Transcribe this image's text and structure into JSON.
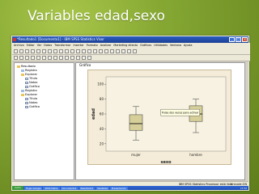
{
  "slide": {
    "title": "Variables edad,sexo"
  },
  "window": {
    "title": "*Resultado1 [Documento1] - IBM SPSS Statistics Visor",
    "tab_title": "Nuevo Resultado",
    "controls": [
      "_",
      "□",
      "×"
    ]
  },
  "menu": {
    "items": [
      "Archivo",
      "Editar",
      "Ver",
      "Datos",
      "Transformar",
      "Insertar",
      "Formato",
      "Analizar",
      "Marketing directo",
      "Gráficos",
      "Utilidades",
      "Ventana",
      "Ayuda"
    ]
  },
  "tree": {
    "items": [
      {
        "label": "Resultado",
        "indent": 0,
        "icon": "folder"
      },
      {
        "label": "Registro",
        "indent": 1,
        "icon": "log"
      },
      {
        "label": "Explorar",
        "indent": 1,
        "icon": "folder"
      },
      {
        "label": "Título",
        "indent": 2,
        "icon": "page"
      },
      {
        "label": "Notas",
        "indent": 2,
        "icon": "page"
      },
      {
        "label": "Gráfico",
        "indent": 2,
        "icon": "page"
      },
      {
        "label": "Registro",
        "indent": 1,
        "icon": "log"
      },
      {
        "label": "Explorar",
        "indent": 1,
        "icon": "folder"
      },
      {
        "label": "Título",
        "indent": 2,
        "icon": "page"
      },
      {
        "label": "Notas",
        "indent": 2,
        "icon": "page"
      },
      {
        "label": "Gráfico",
        "indent": 2,
        "icon": "page"
      }
    ]
  },
  "output": {
    "header": "Gráfico"
  },
  "chart_data": {
    "type": "boxplot",
    "ylabel": "edad",
    "xlabel": "sexo",
    "categories": [
      "mujer",
      "hombre"
    ],
    "yticks": [
      20,
      40,
      60,
      80,
      100
    ],
    "ylim": [
      10,
      110
    ],
    "boxes": [
      {
        "category": "mujer",
        "min": 25,
        "q1": 38,
        "median": 47,
        "q3": 59,
        "max": 70
      },
      {
        "category": "hombre",
        "min": 35,
        "q1": 50,
        "median": 60,
        "q3": 71,
        "max": 80
      }
    ],
    "tooltip": "Pulse dos veces para activar"
  },
  "status": {
    "text": "IBM SPSS Statistics Processor está listo",
    "right": "Unicode:ON"
  },
  "taskbar": {
    "start_label": "Inicio",
    "items": [
      "Hojas Google",
      "SPSS Datos",
      "Documento1",
      "Resultado1",
      "Variables",
      "Presentación"
    ],
    "clock": "17:32"
  }
}
